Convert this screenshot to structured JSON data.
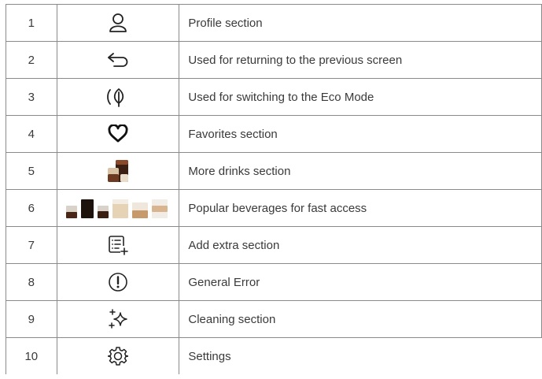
{
  "rows": [
    {
      "num": "1",
      "icon": "user-profile-icon",
      "label": "Profile section"
    },
    {
      "num": "2",
      "icon": "back-arrow-icon",
      "label": "Used for returning to the previous screen"
    },
    {
      "num": "3",
      "icon": "eco-leaf-icon",
      "label": "Used for switching to the Eco Mode"
    },
    {
      "num": "4",
      "icon": "heart-icon",
      "label": "Favorites section"
    },
    {
      "num": "5",
      "icon": "more-drinks-icon",
      "label": "More drinks section"
    },
    {
      "num": "6",
      "icon": "popular-beverages-icon",
      "label": "Popular beverages for fast access"
    },
    {
      "num": "7",
      "icon": "add-extra-list-icon",
      "label": "Add extra section"
    },
    {
      "num": "8",
      "icon": "error-exclamation-icon",
      "label": "General Error"
    },
    {
      "num": "9",
      "icon": "sparkles-icon",
      "label": "Cleaning section"
    },
    {
      "num": "10",
      "icon": "settings-gear-icon",
      "label": "Settings"
    }
  ]
}
